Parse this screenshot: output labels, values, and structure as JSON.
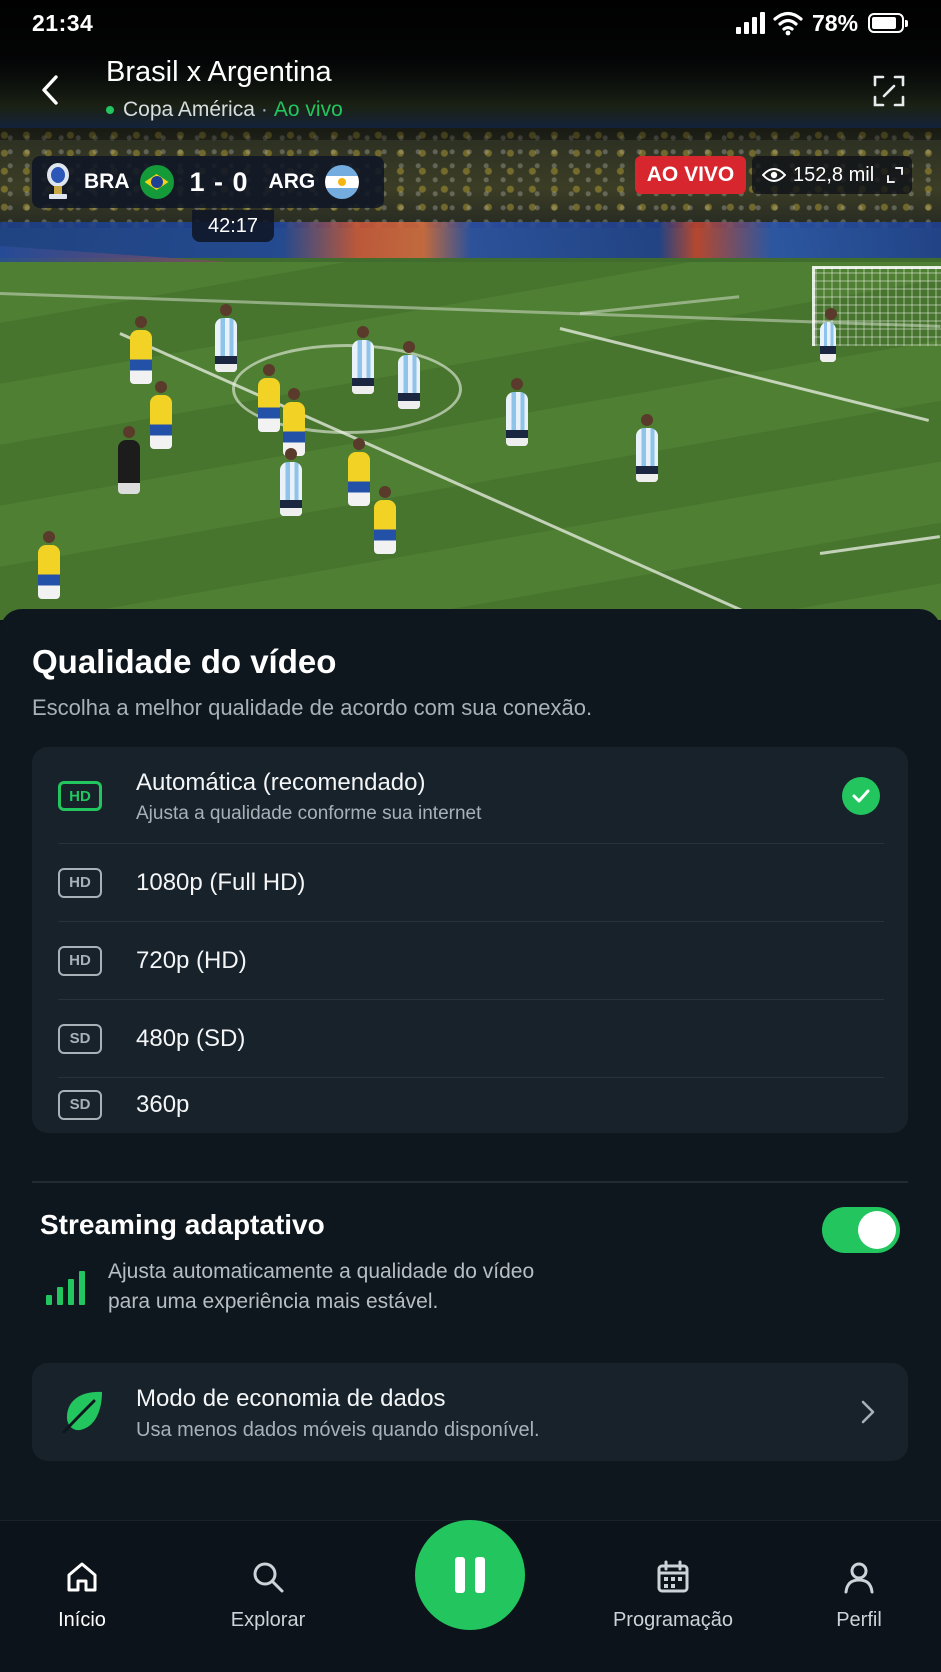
{
  "status_bar": {
    "time": "21:34",
    "battery": "78%"
  },
  "header": {
    "title": "Brasil x Argentina",
    "competition": "Copa América",
    "separator": "·",
    "live_text": "Ao vivo"
  },
  "scoreboard": {
    "home": "BRA",
    "away": "ARG",
    "score": "1 - 0",
    "clock": "42:17"
  },
  "live_badge": "AO VIVO",
  "viewers": "152,8 mil",
  "quality": {
    "title": "Qualidade do vídeo",
    "subtitle": "Escolha a melhor qualidade de acordo com sua conexão.",
    "options": [
      {
        "badge": "HD",
        "label": "Automática (recomendado)",
        "desc": "Ajusta a qualidade conforme sua internet",
        "selected": true
      },
      {
        "badge": "HD",
        "label": "1080p (Full HD)"
      },
      {
        "badge": "HD",
        "label": "720p (HD)"
      },
      {
        "badge": "SD",
        "label": "480p (SD)"
      },
      {
        "badge": "SD",
        "label": "360p"
      }
    ]
  },
  "adaptive": {
    "title": "Streaming adaptativo",
    "desc_line1": "Ajusta automaticamente a qualidade do vídeo",
    "desc_line2": "para uma experiência mais estável.",
    "enabled": true
  },
  "economy": {
    "title": "Modo de economia de dados",
    "subtitle": "Usa menos dados móveis quando disponível."
  },
  "nav": {
    "home": "Início",
    "explore": "Explorar",
    "schedule": "Programação",
    "profile": "Perfil"
  },
  "colors": {
    "accent": "#22c55e",
    "live": "#d7262e",
    "background": "#0f171e"
  }
}
